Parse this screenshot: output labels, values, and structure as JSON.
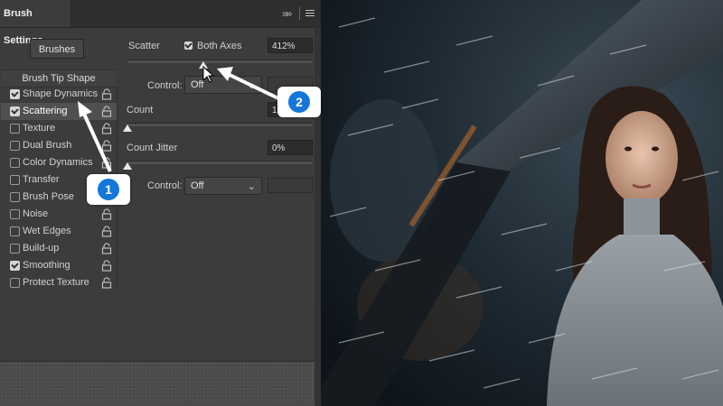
{
  "panel": {
    "title": "Brush Settings",
    "collapse_glyph": "»»",
    "menu_icon": "hamburger-menu-icon",
    "brushes_button": "Brushes",
    "brush_tip_shape": "Brush Tip Shape",
    "items": [
      {
        "label": "Shape Dynamics",
        "checked": true
      },
      {
        "label": "Scattering",
        "checked": true,
        "selected": true
      },
      {
        "label": "Texture",
        "checked": false
      },
      {
        "label": "Dual Brush",
        "checked": false
      },
      {
        "label": "Color Dynamics",
        "checked": false
      },
      {
        "label": "Transfer",
        "checked": false
      },
      {
        "label": "Brush Pose",
        "checked": false
      },
      {
        "label": "Noise",
        "checked": false
      },
      {
        "label": "Wet Edges",
        "checked": false
      },
      {
        "label": "Build-up",
        "checked": false
      },
      {
        "label": "Smoothing",
        "checked": true
      },
      {
        "label": "Protect Texture",
        "checked": false
      }
    ]
  },
  "scatter": {
    "label": "Scatter",
    "both_axes_label": "Both Axes",
    "both_axes_checked": true,
    "value": "412%",
    "control_label": "Control:",
    "control_value": "Off"
  },
  "count": {
    "label": "Count",
    "value": "1"
  },
  "count_jitter": {
    "label": "Count Jitter",
    "value": "0%",
    "control_label": "Control:",
    "control_value": "Off"
  },
  "callouts": {
    "one": "1",
    "two": "2"
  },
  "colors": {
    "panel_bg": "#3c3c3c",
    "badge_blue": "#1477d9",
    "callout_bg": "#ffffff"
  }
}
